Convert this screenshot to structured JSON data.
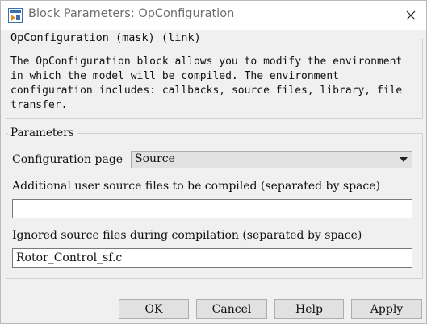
{
  "window": {
    "title": "Block Parameters: OpConfiguration"
  },
  "description": {
    "legend": "OpConfiguration (mask) (link)",
    "text": "The OpConfiguration block allows you to modify the environment\nin which the model will be compiled. The environment\nconfiguration includes: callbacks, source files, library, file\ntransfer."
  },
  "parameters": {
    "legend": "Parameters",
    "config_page_label": "Configuration page",
    "config_page_value": "Source",
    "additional_label": "Additional user source files to be compiled (separated by space)",
    "additional_value": "",
    "ignored_label": "Ignored source files during compilation (separated by space)",
    "ignored_value": "Rotor_Control_sf.c"
  },
  "buttons": {
    "ok": "OK",
    "cancel": "Cancel",
    "help": "Help",
    "apply": "Apply"
  },
  "icons": {
    "app": "simulink-block-icon",
    "close": "close-icon"
  }
}
